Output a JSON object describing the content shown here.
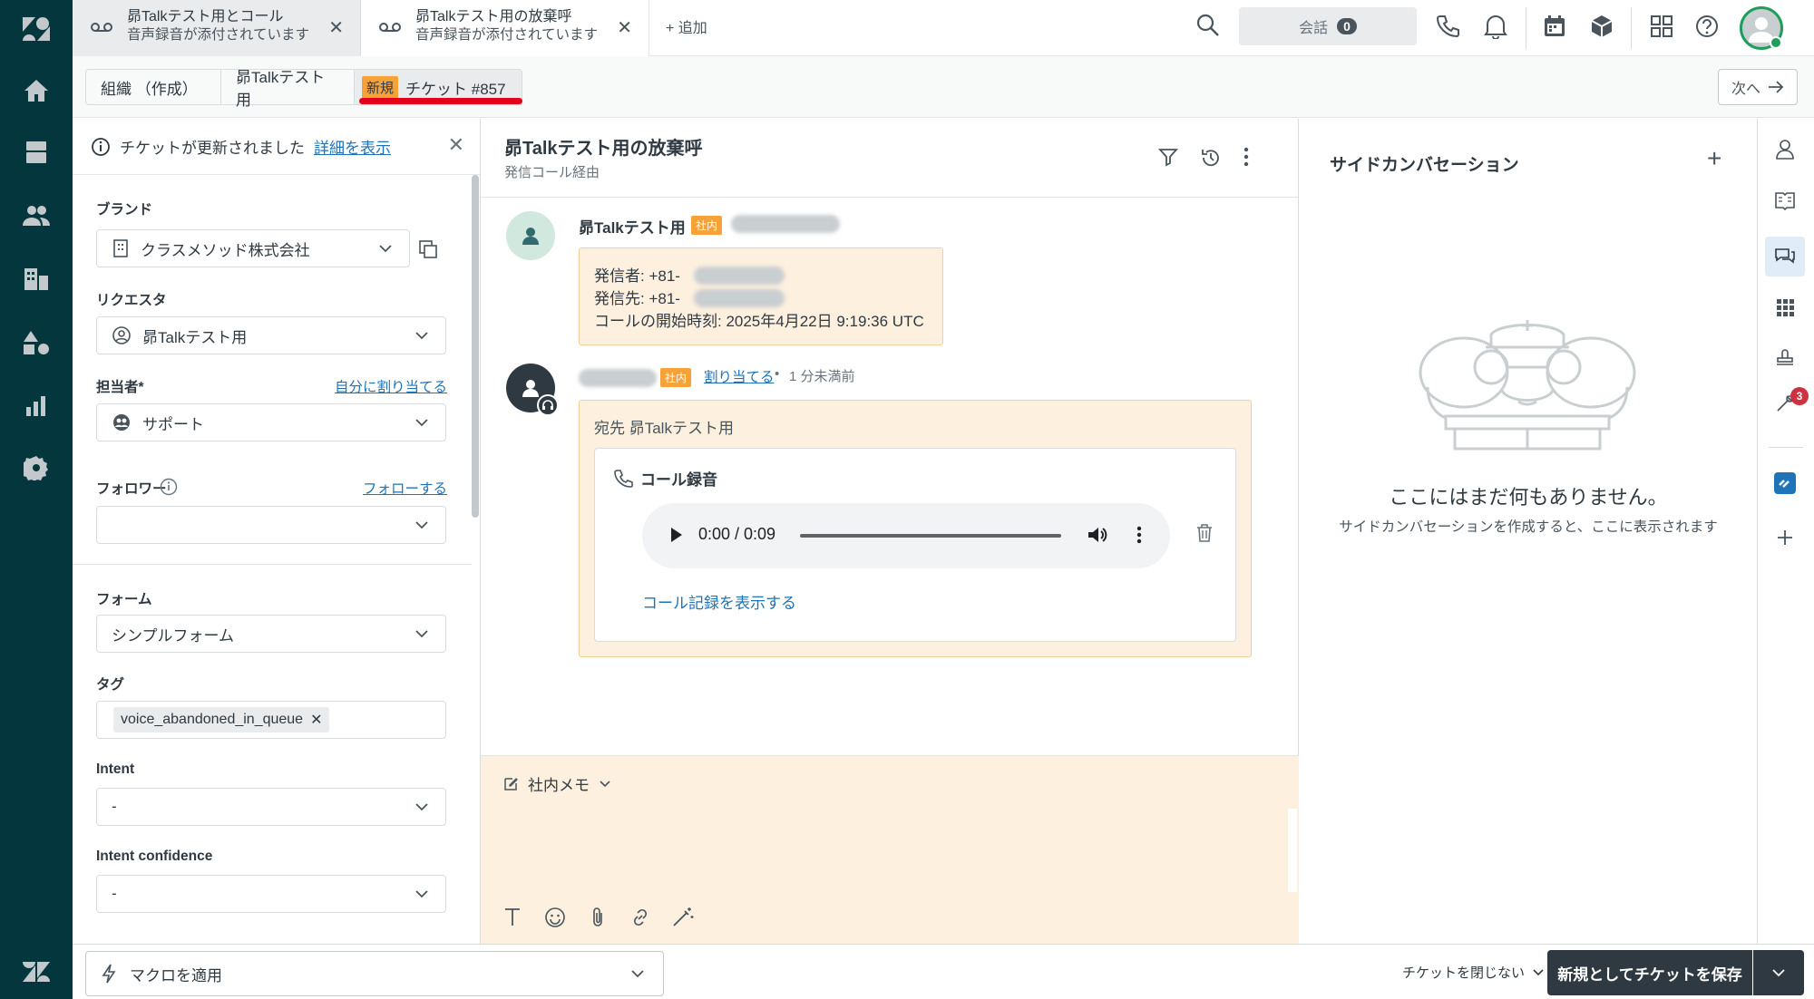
{
  "nav": {
    "items": [
      "logo",
      "home",
      "views",
      "customers",
      "organizations",
      "objects",
      "reporting",
      "admin"
    ]
  },
  "tabs": [
    {
      "title": "昴Talkテスト用とコール",
      "subtitle": "音声録音が添付されています"
    },
    {
      "title": "昴Talkテスト用の放棄呼",
      "subtitle": "音声録音が添付されています"
    }
  ],
  "add_tab_label": "+ 追加",
  "conversations": {
    "label": "会話",
    "count": "0"
  },
  "breadcrumb": {
    "org": "組織 （作成）",
    "user": "昴Talkテスト用",
    "status_badge": "新規",
    "ticket": "チケット #857"
  },
  "next_button": "次へ",
  "notice": {
    "text": "チケットが更新されました",
    "link": "詳細を表示"
  },
  "fields": {
    "brand_label": "ブランド",
    "brand_value": "クラスメソッド株式会社",
    "requester_label": "リクエスタ",
    "requester_value": "昴Talkテスト用",
    "assignee_label": "担当者*",
    "assignee_link": "自分に割り当てる",
    "assignee_value": "サポート",
    "follower_label": "フォロワー",
    "follower_link": "フォローする",
    "form_label": "フォーム",
    "form_value": "シンプルフォーム",
    "tags_label": "タグ",
    "tag_value": "voice_abandoned_in_queue",
    "intent_label": "Intent",
    "intent_value": "-",
    "intent_conf_label": "Intent confidence",
    "intent_conf_value": "-"
  },
  "ticket": {
    "title": "昴Talkテスト用の放棄呼",
    "subtitle": "発信コール経由"
  },
  "messages": [
    {
      "sender": "昴Talkテスト用",
      "badge": "社内",
      "line1": "発信者: +81-",
      "line2": "発信先: +81-",
      "line3": "コールの開始時刻: 2025年4月22日 9:19:36 UTC"
    },
    {
      "badge": "社内",
      "assign_link": "割り当てる",
      "separator": "•",
      "time": "1 分未満前",
      "to_line": "宛先 昴Talkテスト用",
      "recording_title": "コール録音",
      "player_time": "0:00 / 0:09",
      "progress": 0,
      "call_log_link": "コール記録を表示する"
    }
  ],
  "composer": {
    "mode": "社内メモ"
  },
  "side": {
    "title": "サイドカンバセーション",
    "empty_title": "ここにはまだ何もありません。",
    "empty_sub": "サイドカンバセーションを作成すると、ここに表示されます"
  },
  "rail": {
    "badge": "3"
  },
  "bottom": {
    "macro": "マクロを適用",
    "close_option": "チケットを閉じない",
    "save_button": "新規としてチケットを保存"
  }
}
